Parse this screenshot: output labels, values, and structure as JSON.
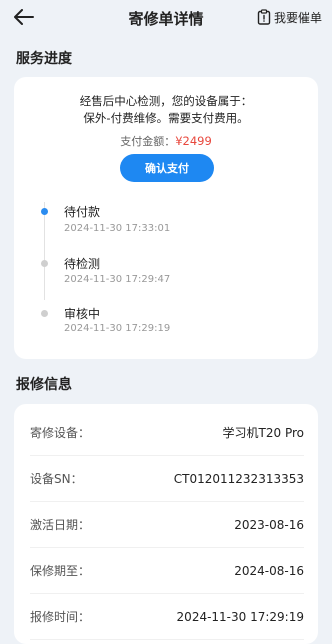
{
  "header": {
    "title": "寄修单详情",
    "urge_label": "我要催单",
    "back_icon": "arrow-left-icon",
    "urge_icon": "clipboard-icon"
  },
  "progress": {
    "section_title": "服务进度",
    "notice_line1": "经售后中心检测，您的设备属于：",
    "notice_line2": "保外-付费维修。需要支付费用。",
    "amount_label": "支付金额：",
    "amount_value": "¥2499",
    "pay_button": "确认支付",
    "steps": [
      {
        "label": "待付款",
        "time": "2024-11-30 17:33:01",
        "active": true
      },
      {
        "label": "待检测",
        "time": "2024-11-30 17:29:47",
        "active": false
      },
      {
        "label": "审核中",
        "time": "2024-11-30 17:29:19",
        "active": false
      }
    ]
  },
  "repair_info": {
    "section_title": "报修信息",
    "rows": [
      {
        "key": "寄修设备：",
        "value": "学习机T20 Pro"
      },
      {
        "key": "设备SN：",
        "value": "CT012011232313353"
      },
      {
        "key": "激活日期：",
        "value": "2023-08-16"
      },
      {
        "key": "保修期至：",
        "value": "2024-08-16"
      },
      {
        "key": "报修时间：",
        "value": "2024-11-30 17:29:19"
      }
    ]
  },
  "colors": {
    "accent": "#1e88f2",
    "price": "#e8473c",
    "background": "#eef2f7"
  }
}
